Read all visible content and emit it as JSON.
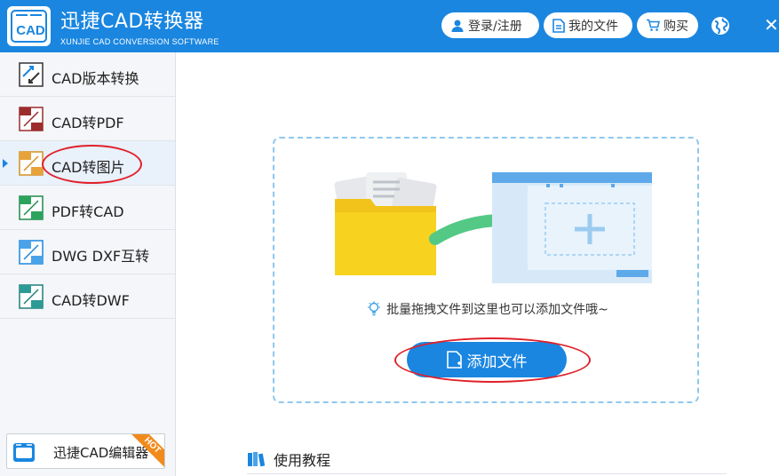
{
  "header": {
    "logo_text": "CAD",
    "app_title": "迅捷CAD转换器",
    "app_subtitle": "XUNJIE CAD CONVERSION SOFTWARE",
    "login_label": "登录/注册",
    "my_files_label": "我的文件",
    "buy_label": "购买",
    "brand_color": "#1a86e0"
  },
  "sidebar": {
    "items": [
      {
        "label": "CAD版本转换",
        "icon": "cad-version-icon"
      },
      {
        "label": "CAD转PDF",
        "icon": "cad-to-pdf-icon"
      },
      {
        "label": "CAD转图片",
        "icon": "cad-to-image-icon",
        "active": true
      },
      {
        "label": "PDF转CAD",
        "icon": "pdf-to-cad-icon"
      },
      {
        "label": "DWG DXF互转",
        "icon": "dwg-dxf-icon"
      },
      {
        "label": "CAD转DWF",
        "icon": "cad-to-dwf-icon"
      }
    ],
    "editor_label": "迅捷CAD编辑器",
    "hot_badge": "HOT"
  },
  "main": {
    "tip_text": "批量拖拽文件到这里也可以添加文件哦~",
    "add_file_label": "添加文件",
    "tutorial_label": "使用教程"
  }
}
